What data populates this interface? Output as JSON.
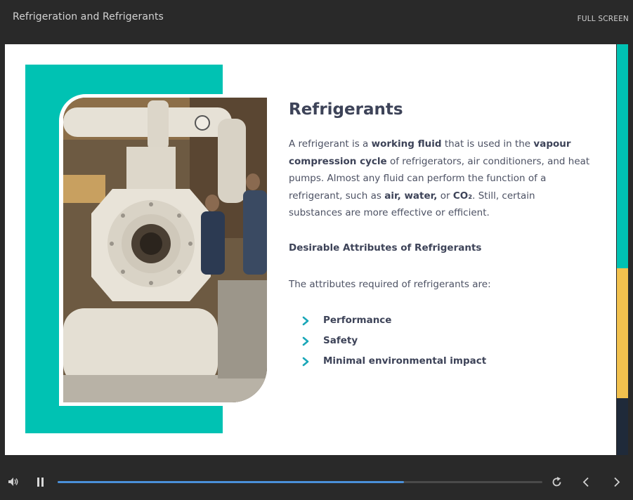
{
  "header": {
    "course_title": "Refrigeration and Refrigerants",
    "fullscreen_label": "FULL SCREEN"
  },
  "slide": {
    "heading": "Refrigerants",
    "paragraph": [
      {
        "text": "A refrigerant is a ",
        "bold": false
      },
      {
        "text": "working fluid",
        "bold": true
      },
      {
        "text": " that is used in the ",
        "bold": false
      },
      {
        "text": "vapour compression cycle",
        "bold": true
      },
      {
        "text": " of refrigerators, air conditioners, and heat pumps. Almost any fluid can perform the function of a refrigerant, such as ",
        "bold": false
      },
      {
        "text": "air, water,",
        "bold": true
      },
      {
        "text": " or ",
        "bold": false
      },
      {
        "text": "CO₂",
        "bold": true
      },
      {
        "text": ". Still, certain substances are more effective or efficient.",
        "bold": false
      }
    ],
    "subheading": "Desirable Attributes of Refrigerants",
    "intro": "The attributes required of refrigerants are:",
    "attributes": [
      "Performance",
      "Safety",
      "Minimal environmental impact"
    ],
    "image_icon": "industrial-compressor-photo",
    "bullet_icon": "chevron-right-icon"
  },
  "colors": {
    "accent_teal": "#00c2b3",
    "accent_yellow": "#f2c14e",
    "dark_navy": "#1f2a3a",
    "progress_blue": "#4a90d9",
    "bar_background": "#292929"
  },
  "progress_strip": [
    {
      "color": "#00c2b3",
      "fraction": 0.545
    },
    {
      "color": "#f2c14e",
      "fraction": 0.316
    },
    {
      "color": "#1f2a3a",
      "fraction": 0.139
    }
  ],
  "player": {
    "progress": 0.715,
    "icons": {
      "volume": "speaker-icon",
      "pause": "pause-icon",
      "replay": "replay-icon",
      "prev": "chevron-left-icon",
      "next": "chevron-right-icon"
    }
  }
}
